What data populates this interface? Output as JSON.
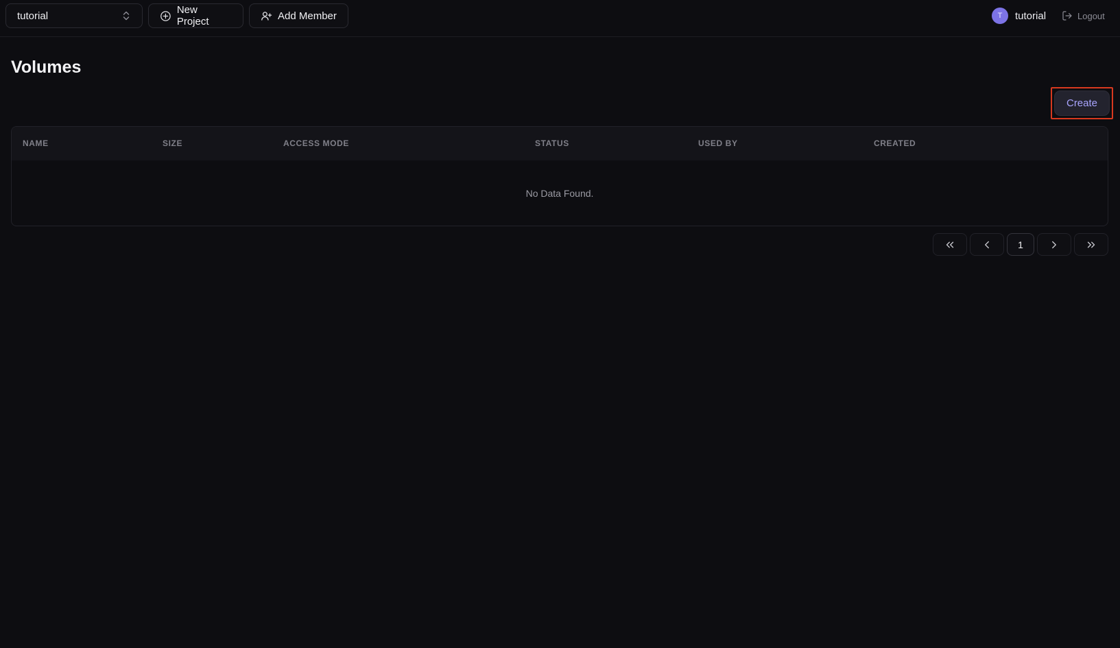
{
  "topbar": {
    "project_select": {
      "value": "tutorial",
      "icon": "chevrons-up-down-icon"
    },
    "new_project_label": "New Project",
    "add_member_label": "Add Member",
    "user": {
      "avatar_initial": "T",
      "name": "tutorial",
      "avatar_color": "#7c73e6"
    },
    "logout_label": "Logout"
  },
  "page": {
    "title": "Volumes"
  },
  "actions": {
    "create_label": "Create",
    "highlight_color": "#d8391f"
  },
  "table": {
    "columns": [
      "NAME",
      "SIZE",
      "ACCESS MODE",
      "STATUS",
      "USED BY",
      "CREATED"
    ],
    "rows": [],
    "empty_text": "No Data Found."
  },
  "pagination": {
    "current_page": "1",
    "buttons": [
      "first-page",
      "previous-page",
      "next-page",
      "last-page"
    ]
  }
}
